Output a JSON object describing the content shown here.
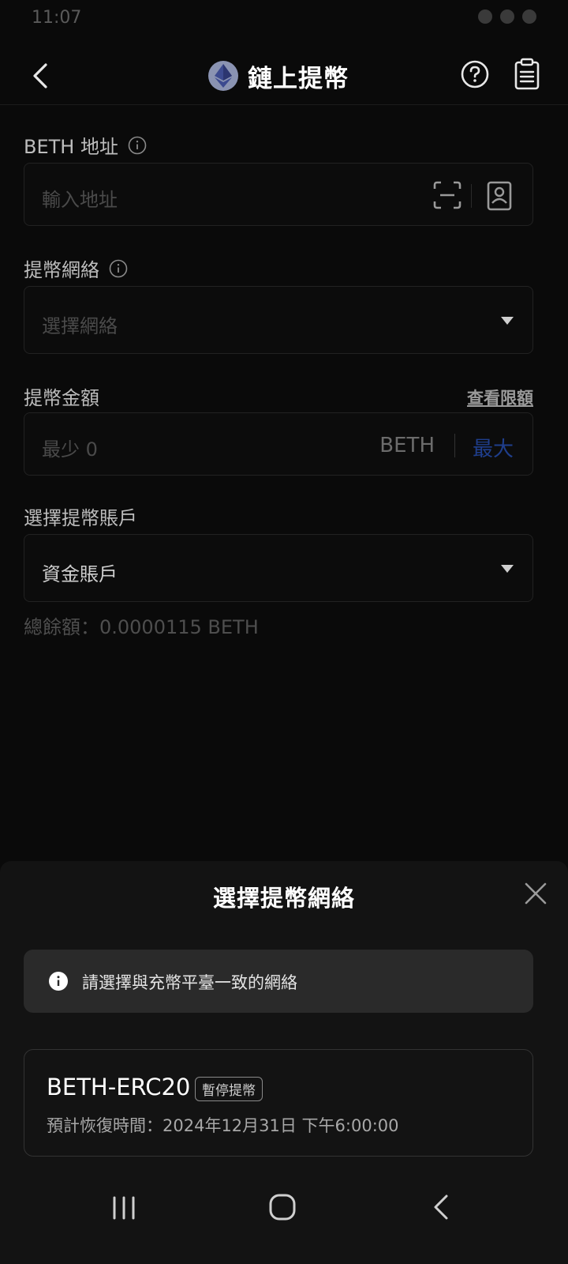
{
  "status_bar": {
    "time": "11:07"
  },
  "header": {
    "title": "鏈上提幣",
    "coin_icon": "ethereum-icon",
    "back_icon": "chevron-left-icon",
    "help_icon": "question-circle-icon",
    "records_icon": "clipboard-icon"
  },
  "form": {
    "address": {
      "label": "BETH 地址",
      "placeholder": "輸入地址"
    },
    "network": {
      "label": "提幣網絡",
      "placeholder": "選擇網絡"
    },
    "amount": {
      "label": "提幣金額",
      "limits_link": "查看限額",
      "placeholder": "最少 0",
      "unit": "BETH",
      "max_label": "最大"
    },
    "account": {
      "label": "選擇提幣賬戶",
      "value": "資金賬戶"
    },
    "balance": "總餘額：0.0000115 BETH"
  },
  "sheet": {
    "title": "選擇提幣網絡",
    "notice": "請選擇與充幣平臺一致的網絡",
    "networks": [
      {
        "name": "BETH-ERC20",
        "badge": "暫停提幣",
        "recovery": "預計恢復時間：2024年12月31日 下午6:00:00"
      }
    ]
  },
  "colors": {
    "background": "#0a0a0a",
    "sheet": "#131313",
    "notice_bg": "#2a2a2a",
    "max_link": "#1f3e8c",
    "eth_badge": "#8a93b2"
  }
}
